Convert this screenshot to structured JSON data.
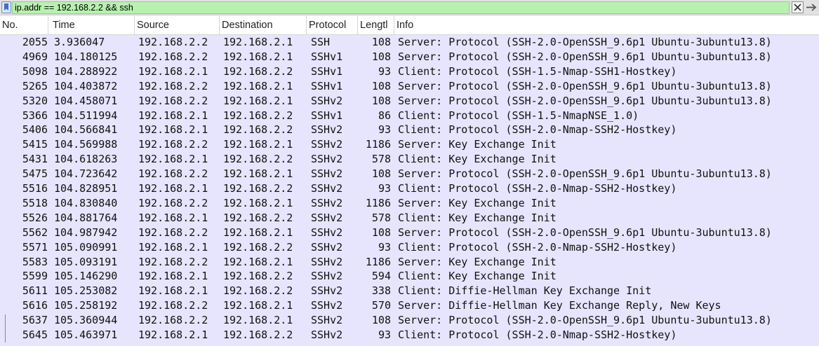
{
  "filter": {
    "value": "ip.addr == 192.168.2.2 && ssh",
    "clear_icon": "clear-x-icon",
    "apply_icon": "arrow-right-icon",
    "bookmark_icon": "bookmark-icon"
  },
  "columns": {
    "no": "No.",
    "time": "Time",
    "source": "Source",
    "destination": "Destination",
    "protocol": "Protocol",
    "length": "Lengtl",
    "info": "Info"
  },
  "colors": {
    "filter_ok": "#b8f0b0",
    "row_bg": "#e6e5fd"
  },
  "packets": [
    {
      "no": "2055",
      "time": "3.936047",
      "src": "192.168.2.2",
      "dst": "192.168.2.1",
      "proto": "SSH",
      "len": "108",
      "info": "Server: Protocol (SSH-2.0-OpenSSH_9.6p1 Ubuntu-3ubuntu13.8)"
    },
    {
      "no": "4969",
      "time": "104.180125",
      "src": "192.168.2.2",
      "dst": "192.168.2.1",
      "proto": "SSHv1",
      "len": "108",
      "info": "Server: Protocol (SSH-2.0-OpenSSH_9.6p1 Ubuntu-3ubuntu13.8)"
    },
    {
      "no": "5098",
      "time": "104.288922",
      "src": "192.168.2.1",
      "dst": "192.168.2.2",
      "proto": "SSHv1",
      "len": "93",
      "info": "Client: Protocol (SSH-1.5-Nmap-SSH1-Hostkey)"
    },
    {
      "no": "5265",
      "time": "104.403872",
      "src": "192.168.2.2",
      "dst": "192.168.2.1",
      "proto": "SSHv1",
      "len": "108",
      "info": "Server: Protocol (SSH-2.0-OpenSSH_9.6p1 Ubuntu-3ubuntu13.8)"
    },
    {
      "no": "5320",
      "time": "104.458071",
      "src": "192.168.2.2",
      "dst": "192.168.2.1",
      "proto": "SSHv2",
      "len": "108",
      "info": "Server: Protocol (SSH-2.0-OpenSSH_9.6p1 Ubuntu-3ubuntu13.8)"
    },
    {
      "no": "5366",
      "time": "104.511994",
      "src": "192.168.2.1",
      "dst": "192.168.2.2",
      "proto": "SSHv1",
      "len": "86",
      "info": "Client: Protocol (SSH-1.5-NmapNSE_1.0)"
    },
    {
      "no": "5406",
      "time": "104.566841",
      "src": "192.168.2.1",
      "dst": "192.168.2.2",
      "proto": "SSHv2",
      "len": "93",
      "info": "Client: Protocol (SSH-2.0-Nmap-SSH2-Hostkey)"
    },
    {
      "no": "5415",
      "time": "104.569988",
      "src": "192.168.2.2",
      "dst": "192.168.2.1",
      "proto": "SSHv2",
      "len": "1186",
      "info": "Server: Key Exchange Init"
    },
    {
      "no": "5431",
      "time": "104.618263",
      "src": "192.168.2.1",
      "dst": "192.168.2.2",
      "proto": "SSHv2",
      "len": "578",
      "info": "Client: Key Exchange Init"
    },
    {
      "no": "5475",
      "time": "104.723642",
      "src": "192.168.2.2",
      "dst": "192.168.2.1",
      "proto": "SSHv2",
      "len": "108",
      "info": "Server: Protocol (SSH-2.0-OpenSSH_9.6p1 Ubuntu-3ubuntu13.8)"
    },
    {
      "no": "5516",
      "time": "104.828951",
      "src": "192.168.2.1",
      "dst": "192.168.2.2",
      "proto": "SSHv2",
      "len": "93",
      "info": "Client: Protocol (SSH-2.0-Nmap-SSH2-Hostkey)"
    },
    {
      "no": "5518",
      "time": "104.830840",
      "src": "192.168.2.2",
      "dst": "192.168.2.1",
      "proto": "SSHv2",
      "len": "1186",
      "info": "Server: Key Exchange Init"
    },
    {
      "no": "5526",
      "time": "104.881764",
      "src": "192.168.2.1",
      "dst": "192.168.2.2",
      "proto": "SSHv2",
      "len": "578",
      "info": "Client: Key Exchange Init"
    },
    {
      "no": "5562",
      "time": "104.987942",
      "src": "192.168.2.2",
      "dst": "192.168.2.1",
      "proto": "SSHv2",
      "len": "108",
      "info": "Server: Protocol (SSH-2.0-OpenSSH_9.6p1 Ubuntu-3ubuntu13.8)"
    },
    {
      "no": "5571",
      "time": "105.090991",
      "src": "192.168.2.1",
      "dst": "192.168.2.2",
      "proto": "SSHv2",
      "len": "93",
      "info": "Client: Protocol (SSH-2.0-Nmap-SSH2-Hostkey)"
    },
    {
      "no": "5583",
      "time": "105.093191",
      "src": "192.168.2.2",
      "dst": "192.168.2.1",
      "proto": "SSHv2",
      "len": "1186",
      "info": "Server: Key Exchange Init"
    },
    {
      "no": "5599",
      "time": "105.146290",
      "src": "192.168.2.1",
      "dst": "192.168.2.2",
      "proto": "SSHv2",
      "len": "594",
      "info": "Client: Key Exchange Init"
    },
    {
      "no": "5611",
      "time": "105.253082",
      "src": "192.168.2.1",
      "dst": "192.168.2.2",
      "proto": "SSHv2",
      "len": "338",
      "info": "Client: Diffie-Hellman Key Exchange Init"
    },
    {
      "no": "5616",
      "time": "105.258192",
      "src": "192.168.2.2",
      "dst": "192.168.2.1",
      "proto": "SSHv2",
      "len": "570",
      "info": "Server: Diffie-Hellman Key Exchange Reply, New Keys"
    },
    {
      "no": "5637",
      "time": "105.360944",
      "src": "192.168.2.2",
      "dst": "192.168.2.1",
      "proto": "SSHv2",
      "len": "108",
      "info": "Server: Protocol (SSH-2.0-OpenSSH_9.6p1 Ubuntu-3ubuntu13.8)"
    },
    {
      "no": "5645",
      "time": "105.463971",
      "src": "192.168.2.1",
      "dst": "192.168.2.2",
      "proto": "SSHv2",
      "len": "93",
      "info": "Client: Protocol (SSH-2.0-Nmap-SSH2-Hostkey)"
    }
  ]
}
